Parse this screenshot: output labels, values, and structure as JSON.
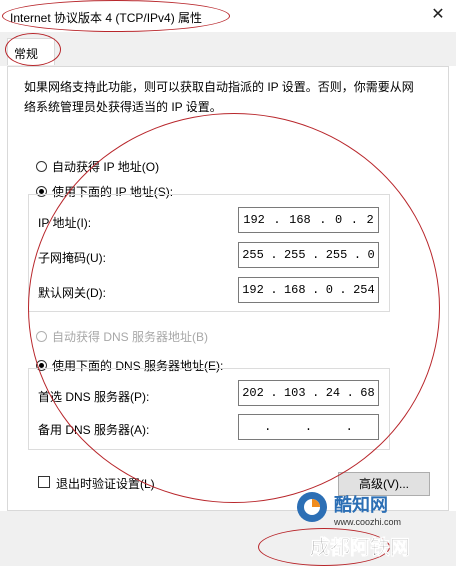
{
  "window": {
    "title": "Internet 协议版本 4 (TCP/IPv4) 属性",
    "close_glyph": "✕"
  },
  "tabs": [
    {
      "label": "常规"
    }
  ],
  "description": "如果网络支持此功能，则可以获取自动指派的 IP 设置。否则，你需要从网络系统管理员处获得适当的 IP 设置。",
  "ip": {
    "auto_label": "自动获得 IP 地址(O)",
    "manual_label": "使用下面的 IP 地址(S):",
    "selected": "manual",
    "fields": [
      {
        "label": "IP 地址(I):",
        "octets": [
          "192",
          "168",
          "0",
          "2"
        ]
      },
      {
        "label": "子网掩码(U):",
        "octets": [
          "255",
          "255",
          "255",
          "0"
        ]
      },
      {
        "label": "默认网关(D):",
        "octets": [
          "192",
          "168",
          "0",
          "254"
        ]
      }
    ]
  },
  "dns": {
    "auto_label": "自动获得 DNS 服务器地址(B)",
    "manual_label": "使用下面的 DNS 服务器地址(E):",
    "selected": "manual",
    "fields": [
      {
        "label": "首选 DNS 服务器(P):",
        "octets": [
          "202",
          "103",
          "24",
          "68"
        ]
      },
      {
        "label": "备用 DNS 服务器(A):",
        "octets": [
          "",
          "",
          "",
          ""
        ]
      }
    ]
  },
  "validate_label": "退出时验证设置(L)",
  "advanced_label": "高级(V)...",
  "watermark": {
    "site_cn": "酷知网",
    "site_url": "www.coozhi.com",
    "bottom_text": "成都阿铁网"
  },
  "colors": {
    "annotation": "#b8262b",
    "watermark_blue": "#2c6fb5",
    "watermark_orange": "#f08c1e"
  }
}
